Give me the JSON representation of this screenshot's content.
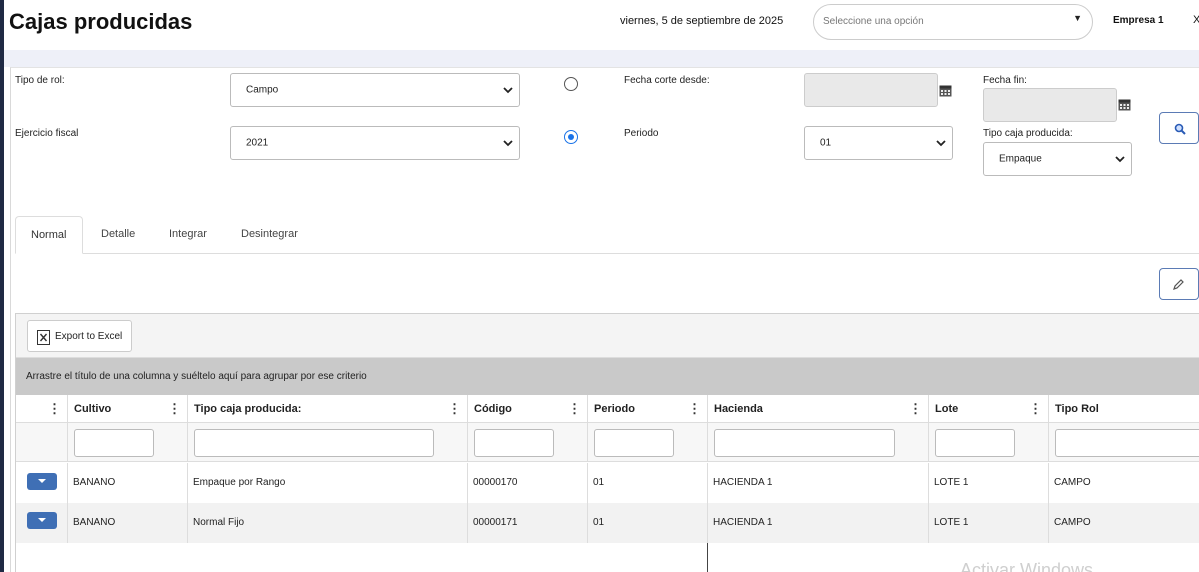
{
  "header": {
    "title": "Cajas producidas",
    "date": "viernes, 5 de septiembre de 2025",
    "option_placeholder": "Seleccione una opción",
    "company": "Empresa 1",
    "close": "X"
  },
  "filters": {
    "tipo_rol_label": "Tipo de rol:",
    "tipo_rol_value": "Campo",
    "ejercicio_label": "Ejercicio fiscal",
    "ejercicio_value": "2021",
    "fecha_corte_label": "Fecha corte desde:",
    "periodo_label": "Periodo",
    "periodo_value": "01",
    "fecha_fin_label": "Fecha fin:",
    "tipo_caja_label": "Tipo caja producida:",
    "tipo_caja_value": "Empaque",
    "radio_fecha_selected": false,
    "radio_periodo_selected": true
  },
  "tabs": [
    "Normal",
    "Detalle",
    "Integrar",
    "Desintegrar"
  ],
  "active_tab": "Normal",
  "grid": {
    "export_label": "Export to Excel",
    "group_hint": "Arrastre el título de una columna y suéltelo aquí para agrupar por ese criterio",
    "columns": [
      "Cultivo",
      "Tipo caja producida:",
      "Código",
      "Periodo",
      "Hacienda",
      "Lote",
      "Tipo Rol"
    ],
    "rows": [
      [
        "BANANO",
        "Empaque por Rango",
        "00000170",
        "01",
        "HACIENDA 1",
        "LOTE 1",
        "CAMPO"
      ],
      [
        "BANANO",
        "Normal Fijo",
        "00000171",
        "01",
        "HACIENDA 1",
        "LOTE 1",
        "CAMPO"
      ]
    ]
  },
  "colors": {
    "accent": "#1a73e8",
    "expander": "#3f6fb5",
    "sidebar": "#1f2a44"
  },
  "watermark": "Activar Windows"
}
